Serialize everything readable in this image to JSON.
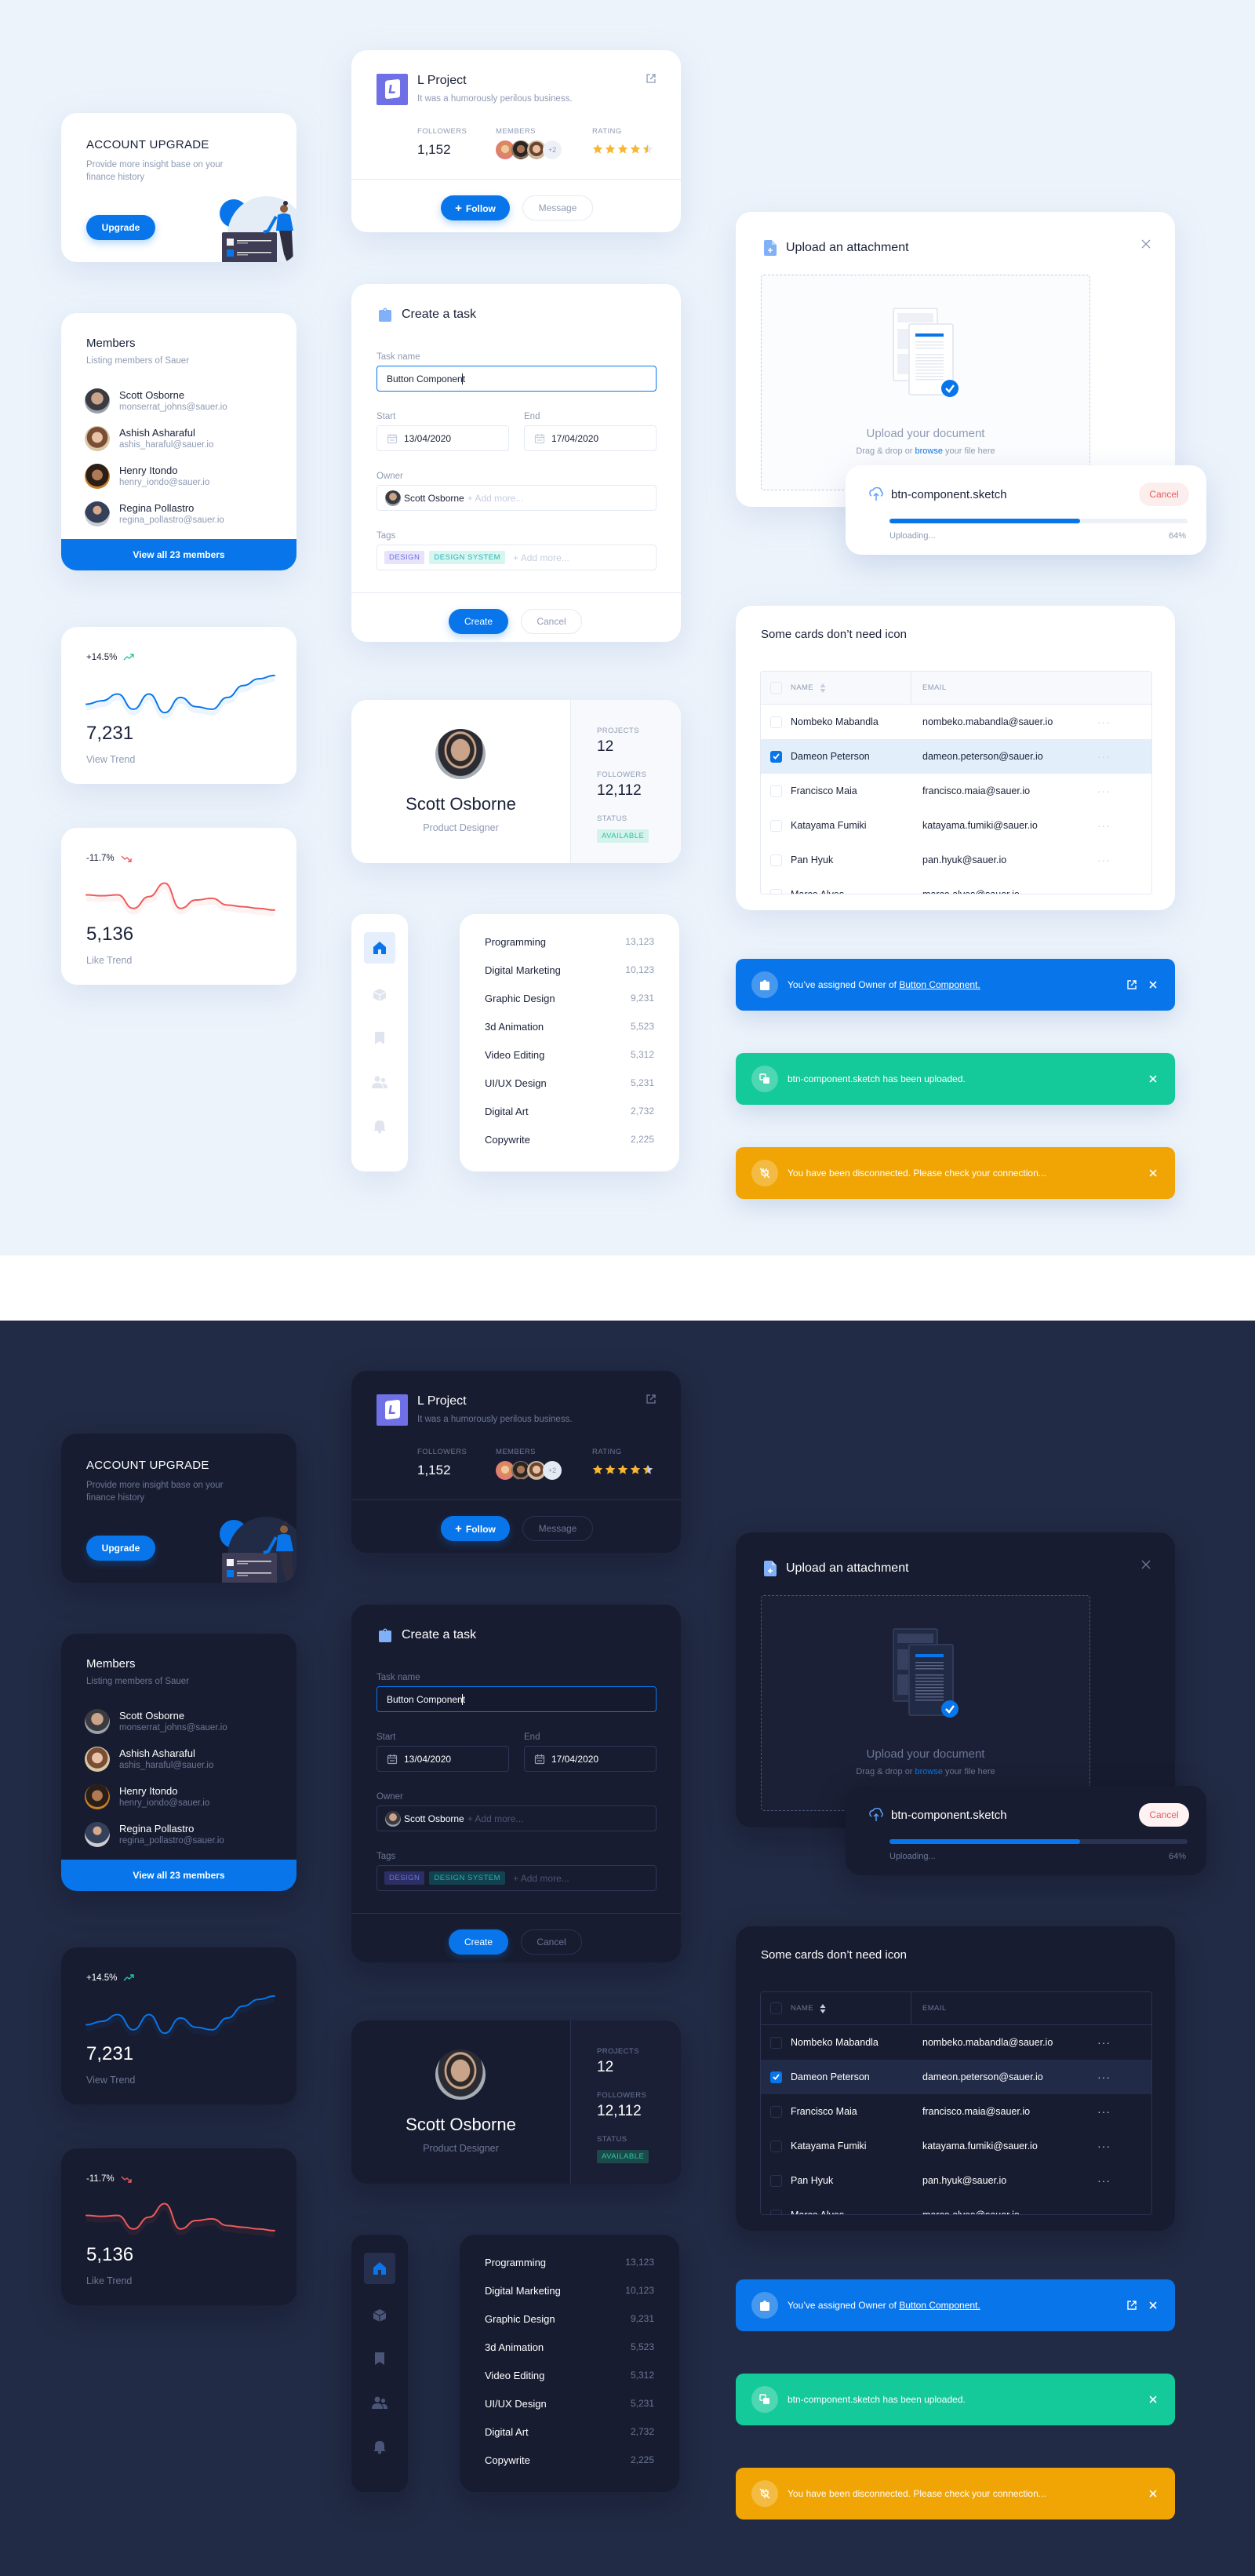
{
  "colors": {
    "primary": "#0876ea",
    "success": "#14c99a",
    "warning": "#f0a504",
    "danger": "#e55c5c",
    "light_bg": "#ecf3fb",
    "dark_bg": "#222b45",
    "dark_card": "#181c30"
  },
  "themes": [
    "light",
    "dark"
  ],
  "account_upgrade": {
    "title": "ACCOUNT UPGRADE",
    "description": "Provide more insight base on your finance history",
    "button": "Upgrade"
  },
  "members_card": {
    "title": "Members",
    "subtitle": "Listing members of Sauer",
    "members": [
      {
        "name": "Scott Osborne",
        "email": "monserrat_johns@sauer.io"
      },
      {
        "name": "Ashish Asharaful",
        "email": "ashis_haraful@sauer.io"
      },
      {
        "name": "Henry Itondo",
        "email": "henry_iondo@sauer.io"
      },
      {
        "name": "Regina Pollastro",
        "email": "regina_pollastro@sauer.io"
      }
    ],
    "view_all": "View all 23 members"
  },
  "trends": [
    {
      "change": "+14.5%",
      "direction": "up",
      "value": "7,231",
      "label": "View Trend",
      "color": "#0876ea",
      "points": [
        50,
        54,
        62,
        44,
        62,
        40,
        58,
        47,
        44,
        58,
        72,
        80,
        84
      ]
    },
    {
      "change": "-11.7%",
      "direction": "down",
      "value": "5,136",
      "label": "Like Trend",
      "color": "#ee5a5a",
      "points": [
        62,
        61,
        62,
        46,
        60,
        76,
        46,
        56,
        58,
        50,
        48,
        46,
        44
      ]
    }
  ],
  "project": {
    "logo_letter": "L",
    "title": "L Project",
    "description": "It was a humorously perilous business.",
    "followers_label": "FOLLOWERS",
    "followers": "1,152",
    "members_label": "MEMBERS",
    "members_more": "+2",
    "rating_label": "RATING",
    "rating": 4.5,
    "rating_max": 5,
    "follow_button": "Follow",
    "message_button": "Message"
  },
  "task_form": {
    "title": "Create a task",
    "task_name_label": "Task name",
    "task_name_value": "Button Component",
    "start_label": "Start",
    "start_value": "13/04/2020",
    "end_label": "End",
    "end_value": "17/04/2020",
    "owner_label": "Owner",
    "owner_value": "Scott Osborne",
    "add_more": "+ Add more...",
    "tags_label": "Tags",
    "tags": [
      "DESIGN",
      "DESIGN SYSTEM"
    ],
    "create_button": "Create",
    "cancel_button": "Cancel"
  },
  "profile": {
    "name": "Scott Osborne",
    "role": "Product Designer",
    "projects_label": "PROJECTS",
    "projects": "12",
    "followers_label": "FOLLOWERS",
    "followers": "12,112",
    "status_label": "STATUS",
    "status": "AVAILABLE"
  },
  "sidenav": {
    "items": [
      {
        "icon": "home-icon",
        "active": true
      },
      {
        "icon": "cube-icon",
        "active": false
      },
      {
        "icon": "bookmark-icon",
        "active": false
      },
      {
        "icon": "users-icon",
        "active": false
      },
      {
        "icon": "bell-icon",
        "active": false
      }
    ]
  },
  "categories": [
    {
      "name": "Programming",
      "count": "13,123"
    },
    {
      "name": "Digital Marketing",
      "count": "10,123"
    },
    {
      "name": "Graphic Design",
      "count": "9,231"
    },
    {
      "name": "3d Animation",
      "count": "5,523"
    },
    {
      "name": "Video Editing",
      "count": "5,312"
    },
    {
      "name": "UI/UX Design",
      "count": "5,231"
    },
    {
      "name": "Digital Art",
      "count": "2,732"
    },
    {
      "name": "Copywrite",
      "count": "2,225"
    }
  ],
  "upload": {
    "title": "Upload an attachment",
    "drop_title": "Upload your document",
    "drop_sub_before": "Drag & drop or ",
    "drop_link": "browse",
    "drop_sub_after": " your file here",
    "file_name": "btn-component.sketch",
    "cancel_button": "Cancel",
    "status": "Uploading...",
    "progress_percent": 64,
    "progress_label": "64%"
  },
  "table_card": {
    "title": "Some cards don’t need icon",
    "columns": [
      "NAME",
      "EMAIL"
    ],
    "rows": [
      {
        "name": "Nombeko Mabandla",
        "email": "nombeko.mabandla@sauer.io",
        "checked": false
      },
      {
        "name": "Dameon Peterson",
        "email": "dameon.peterson@sauer.io",
        "checked": true
      },
      {
        "name": "Francisco Maia",
        "email": "francisco.maia@sauer.io",
        "checked": false
      },
      {
        "name": "Katayama Fumiki",
        "email": "katayama.fumiki@sauer.io",
        "checked": false
      },
      {
        "name": "Pan Hyuk",
        "email": "pan.hyuk@sauer.io",
        "checked": false
      },
      {
        "name": "Marco Alves",
        "email": "marco.alves@sauer.io",
        "checked": false
      }
    ],
    "more_glyph": "···"
  },
  "toasts": {
    "info_prefix": "You’ve assigned Owner of ",
    "info_link": "Button Component.",
    "success": "btn-component.sketch has been uploaded.",
    "warning": "You have been disconnected. Please check your connection..."
  }
}
